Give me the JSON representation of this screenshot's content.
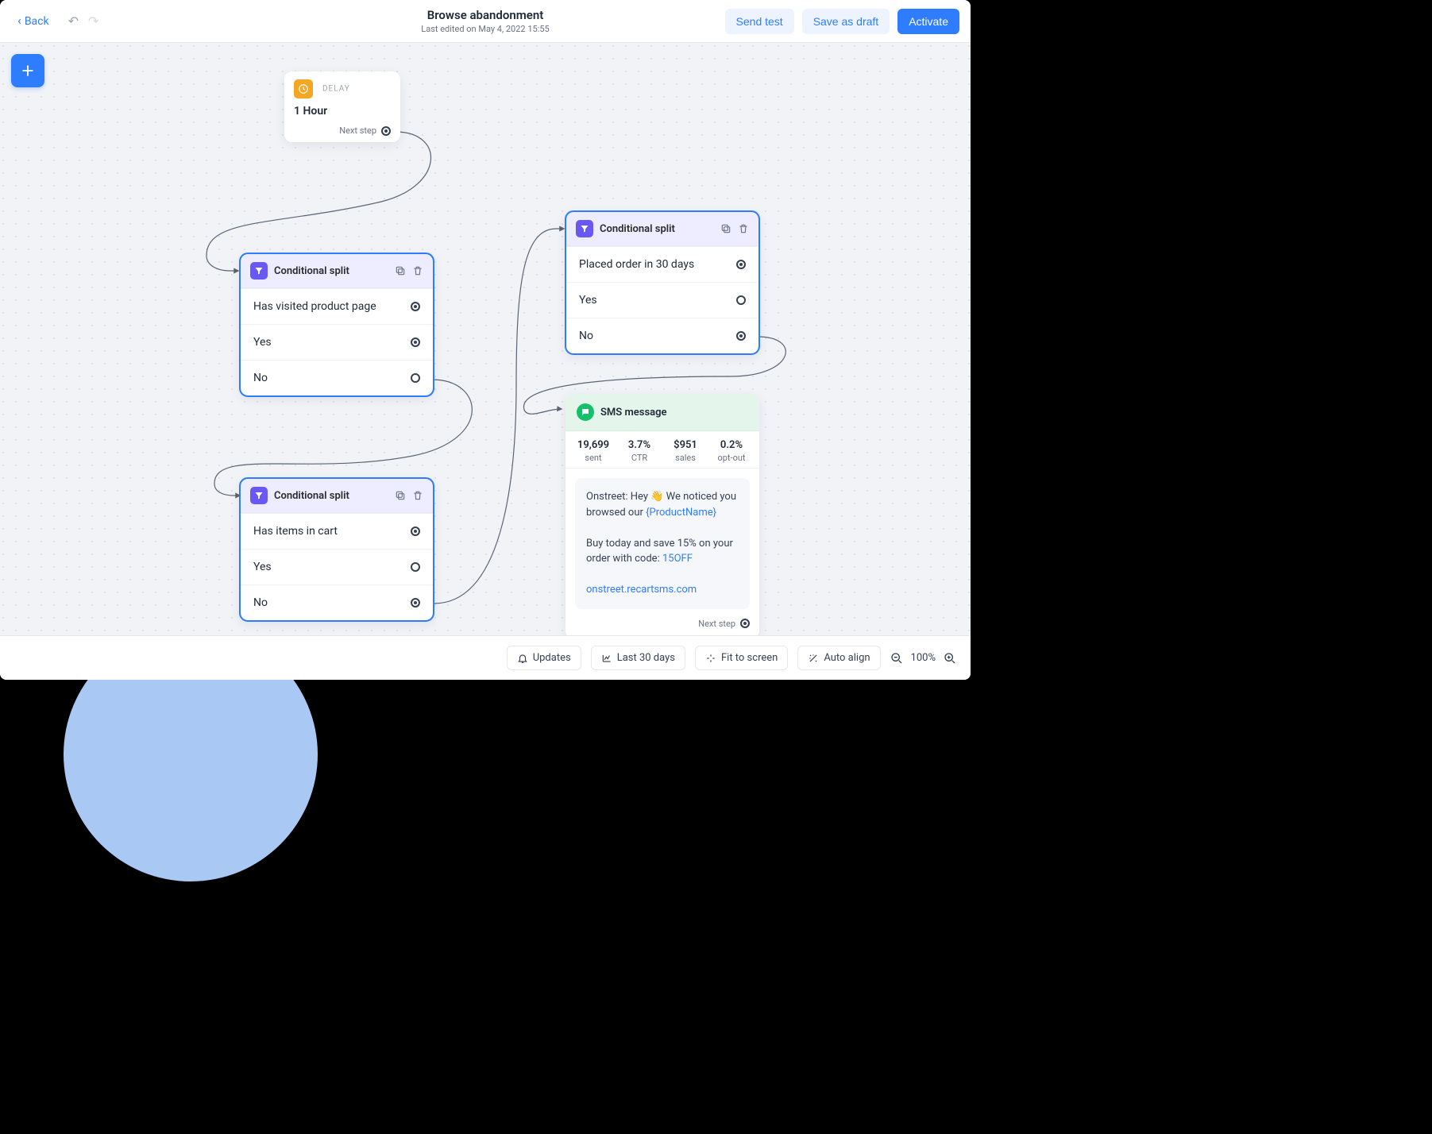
{
  "header": {
    "back_label": "Back",
    "title": "Browse abandonment",
    "subtitle": "Last edited on May 4, 2022 15:55",
    "send_test": "Send test",
    "save_draft": "Save as draft",
    "activate": "Activate"
  },
  "canvas": {
    "delay": {
      "type_label": "DELAY",
      "value": "1 Hour",
      "next_step": "Next step"
    },
    "conditional_label": "Conditional split",
    "cond1": {
      "question": "Has visited product page",
      "yes": "Yes",
      "no": "No"
    },
    "cond2": {
      "question": "Has items in cart",
      "yes": "Yes",
      "no": "No"
    },
    "cond3": {
      "question": "Placed order in 30 days",
      "yes": "Yes",
      "no": "No"
    },
    "sms": {
      "title": "SMS message",
      "stats": [
        {
          "value": "19,699",
          "label": "sent"
        },
        {
          "value": "3.7%",
          "label": "CTR"
        },
        {
          "value": "$951",
          "label": "sales"
        },
        {
          "value": "0.2%",
          "label": "opt-out"
        }
      ],
      "line1a": "Onstreet: Hey ",
      "line1b": " We noticed you browsed our ",
      "token": "{ProductName}",
      "line2a": "Buy today and save 15% on your order with code: ",
      "code": "15OFF",
      "link": "onstreet.recartsms.com",
      "next_step": "Next step"
    }
  },
  "bottombar": {
    "updates": "Updates",
    "last30": "Last 30 days",
    "fit": "Fit to screen",
    "align": "Auto align",
    "zoom_label": "100%"
  }
}
